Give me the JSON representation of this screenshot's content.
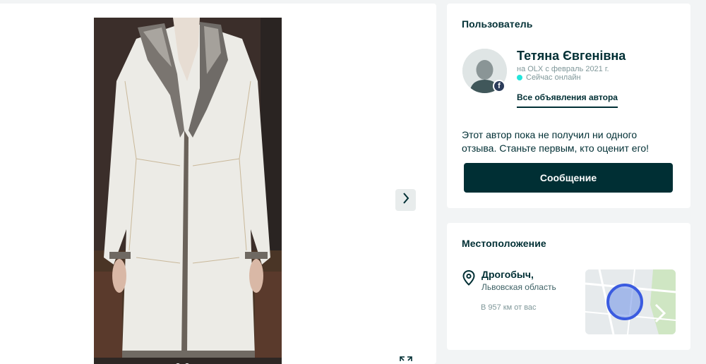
{
  "seller": {
    "section_title": "Пользователь",
    "name": "Тетяна Євгенівна",
    "member_since": "на OLX с февраль 2021 г.",
    "online_status": "Сейчас онлайн",
    "all_ads_link": "Все объявления автора",
    "facebook_badge": "f",
    "review_text": "Этот автор пока не получил ни одного отзыва. Станьте первым, кто оценит его!",
    "message_button": "Сообщение"
  },
  "location": {
    "section_title": "Местоположение",
    "city": "Дрогобыч,",
    "region": "Львовская область",
    "distance": "В 957 км от вас"
  },
  "icons": {
    "next": "chevron-right-icon",
    "expand": "expand-icon",
    "location": "location-pin-icon"
  },
  "colors": {
    "primary": "#002f34",
    "online": "#23e5db",
    "map_circle": "#3a5be0",
    "background": "#f2f4f5"
  }
}
